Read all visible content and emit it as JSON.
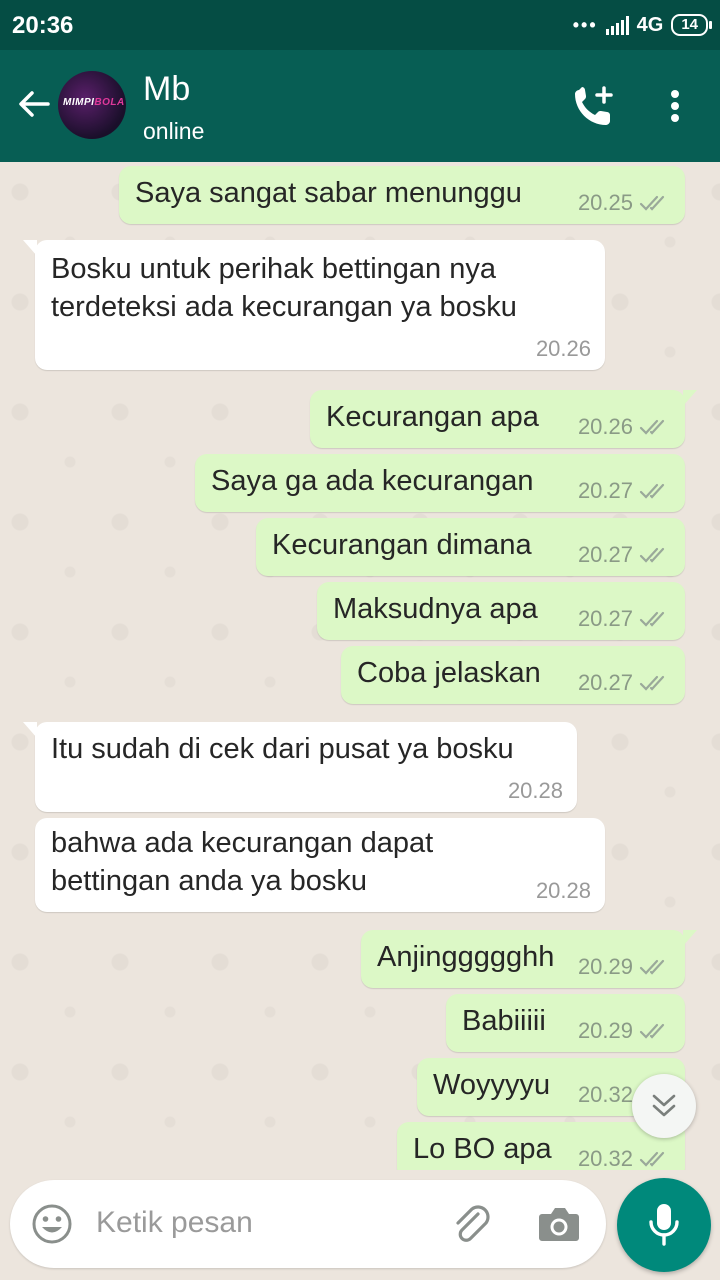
{
  "status_bar": {
    "time": "20:36",
    "network": "4G",
    "battery": "14"
  },
  "header": {
    "contact_name": "Mb",
    "contact_status": "online",
    "avatar_text_a": "MIMPI",
    "avatar_text_b": "BOLA"
  },
  "messages": [
    {
      "direction": "out",
      "text": "Saya sangat sabar menunggu",
      "time": "20.25"
    },
    {
      "direction": "in",
      "text": "Bosku untuk perihak bettingan nya\nterdeteksi ada kecurangan ya bosku",
      "time": "20.26"
    },
    {
      "direction": "out",
      "text": "Kecurangan apa",
      "time": "20.26"
    },
    {
      "direction": "out",
      "text": "Saya ga ada kecurangan",
      "time": "20.27"
    },
    {
      "direction": "out",
      "text": "Kecurangan dimana",
      "time": "20.27"
    },
    {
      "direction": "out",
      "text": "Maksudnya apa",
      "time": "20.27"
    },
    {
      "direction": "out",
      "text": "Coba jelaskan",
      "time": "20.27"
    },
    {
      "direction": "in",
      "text": "Itu sudah di cek dari pusat ya bosku",
      "time": "20.28"
    },
    {
      "direction": "in",
      "text": "bahwa ada kecurangan dapat\nbettingan anda ya bosku",
      "time": "20.28"
    },
    {
      "direction": "out",
      "text": "Anjinggggghh",
      "time": "20.29"
    },
    {
      "direction": "out",
      "text": "Babiiiii",
      "time": "20.29"
    },
    {
      "direction": "out",
      "text": "Woyyyyu",
      "time": "20.32"
    },
    {
      "direction": "out",
      "text": "Lo BO apa",
      "time": "20.32"
    }
  ],
  "composer": {
    "placeholder": "Ketik pesan"
  },
  "colors": {
    "header": "#075e54",
    "status_bar": "#054d44",
    "outgoing_bubble": "#dcf8c6",
    "incoming_bubble": "#ffffff",
    "mic_button": "#00897b",
    "read_tick": "#8a9a86"
  },
  "icons": {
    "back": "arrow-left-icon",
    "call": "add-call-icon",
    "menu": "more-vertical-icon",
    "emoji": "emoji-icon",
    "attach": "paperclip-icon",
    "camera": "camera-icon",
    "mic": "mic-icon",
    "scroll": "chevron-double-down-icon"
  }
}
